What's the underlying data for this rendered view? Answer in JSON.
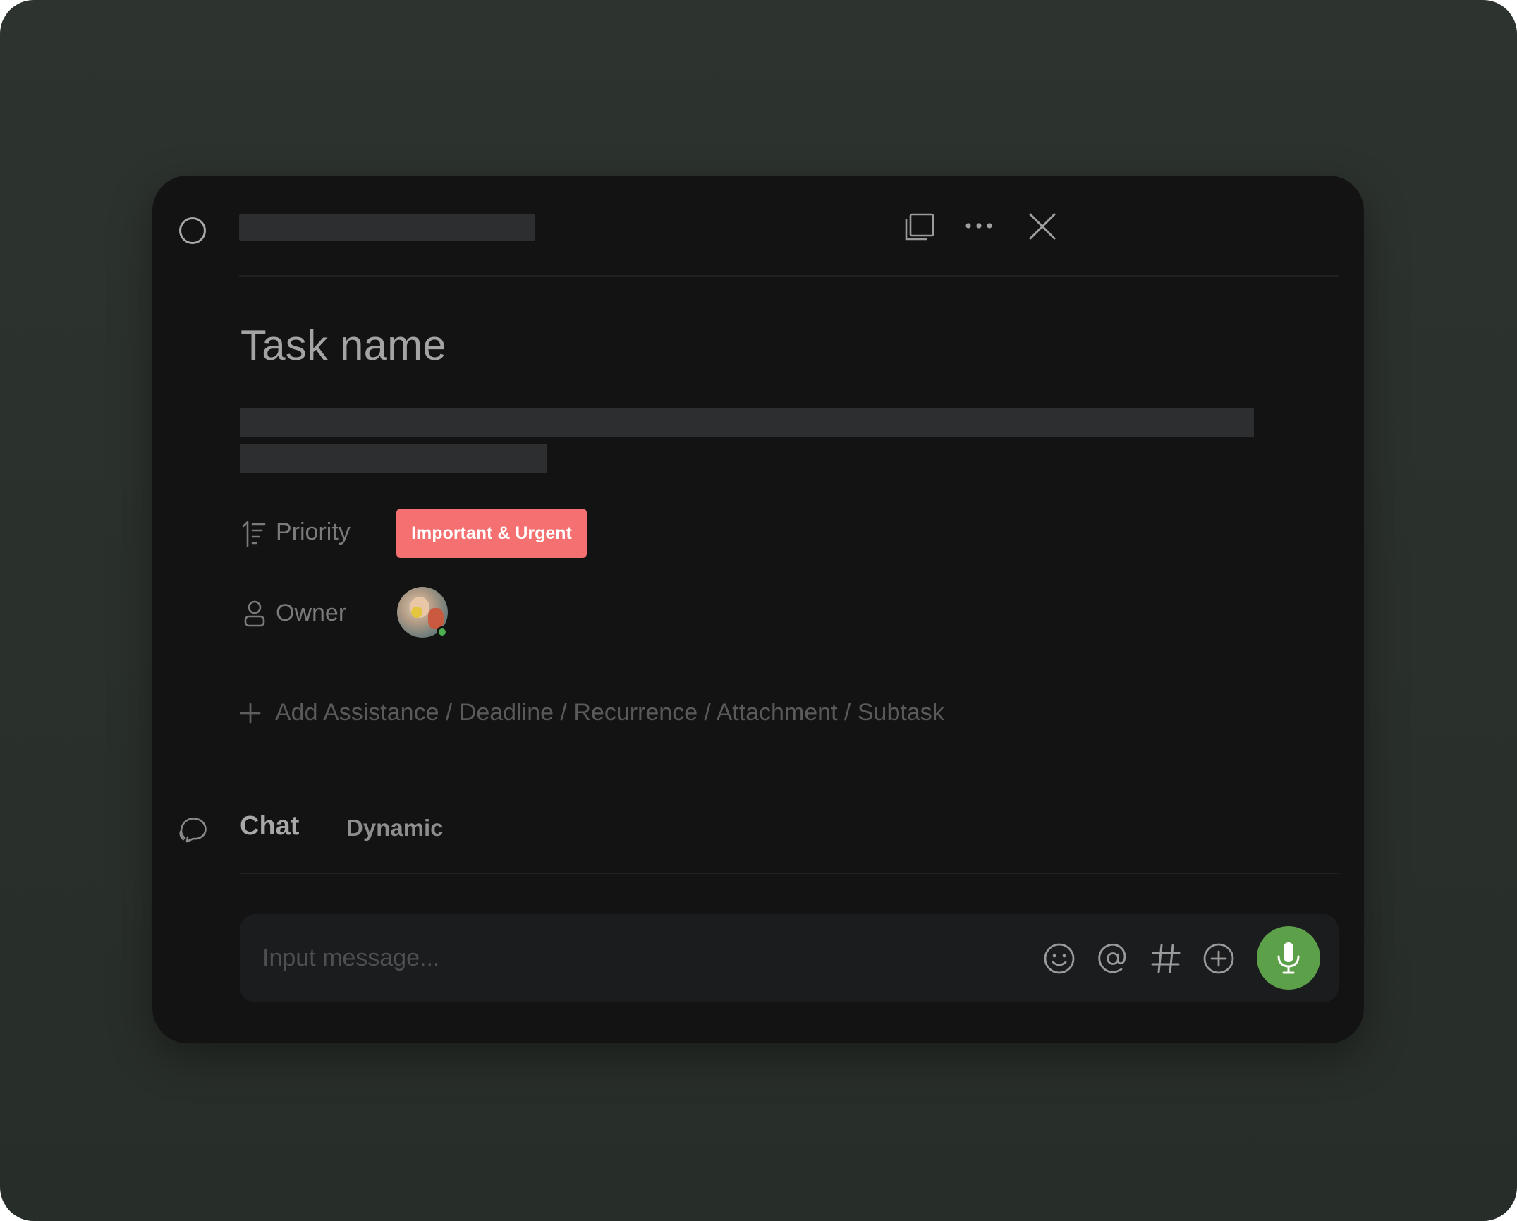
{
  "task": {
    "name": "Task name"
  },
  "fields": {
    "priority": {
      "label": "Priority",
      "value": "Important & Urgent",
      "color": "#f57070"
    },
    "owner": {
      "label": "Owner",
      "online": true,
      "online_color": "#4caf50"
    }
  },
  "add_row": {
    "label": "Add Assistance / Deadline / Recurrence / Attachment / Subtask"
  },
  "tabs": [
    {
      "label": "Chat",
      "active": true
    },
    {
      "label": "Dynamic",
      "active": false
    }
  ],
  "composer": {
    "placeholder": "Input message...",
    "value": "",
    "mic_color": "#5da04a"
  },
  "icons": {
    "status": "circle-outline-icon",
    "window": "window-icon",
    "more": "more-horizontal-icon",
    "close": "close-icon",
    "priority": "priority-sort-icon",
    "owner": "person-icon",
    "add": "plus-icon",
    "chat": "chat-bubbles-icon",
    "emoji": "emoji-icon",
    "mention": "at-icon",
    "topic": "hash-icon",
    "attach": "plus-circle-icon",
    "voice": "microphone-icon"
  }
}
